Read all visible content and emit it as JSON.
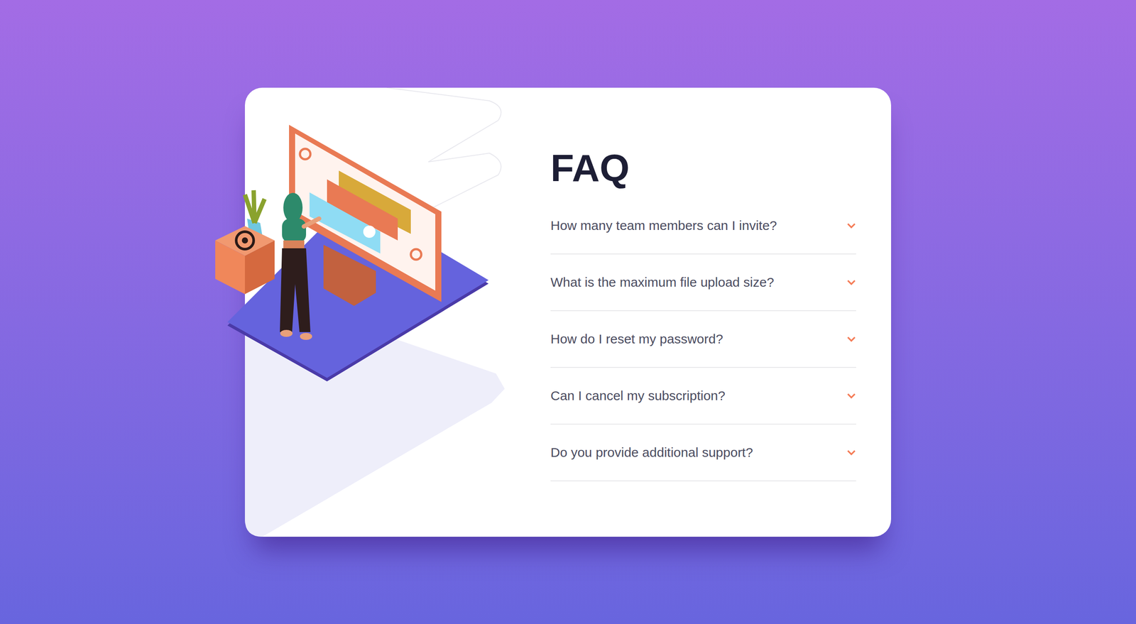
{
  "title": "FAQ",
  "questions": [
    {
      "question": "How many team members can I invite?",
      "expanded": false
    },
    {
      "question": "What is the maximum file upload size?",
      "expanded": false
    },
    {
      "question": "How do I reset my password?",
      "expanded": false
    },
    {
      "question": "Can I cancel my subscription?",
      "expanded": false
    },
    {
      "question": "Do you provide additional support?",
      "expanded": false
    }
  ]
}
